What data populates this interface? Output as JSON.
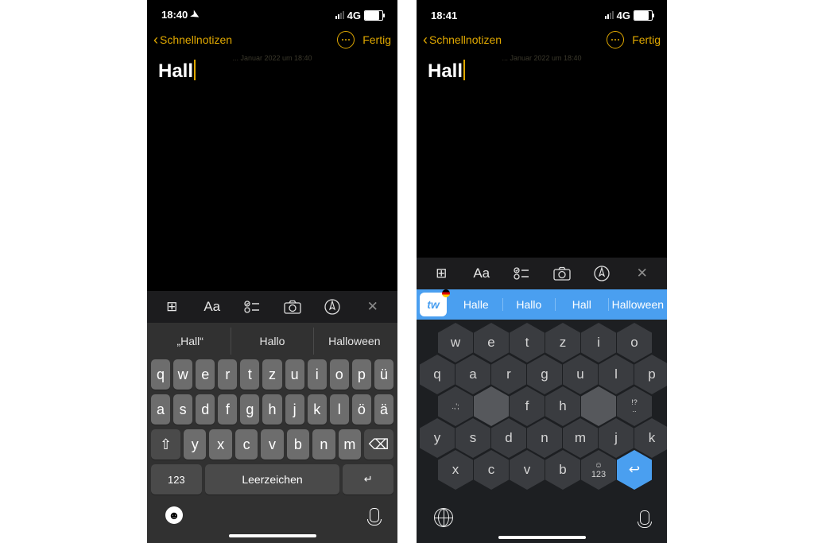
{
  "left": {
    "status": {
      "time": "18:40",
      "net": "4G"
    },
    "header": {
      "back": "Schnellnotizen",
      "done": "Fertig"
    },
    "note": {
      "timestamp": "... Januar 2022 um 18:40",
      "text": "Hall"
    },
    "preds": [
      "„Hall“",
      "Hallo",
      "Halloween"
    ],
    "rows": {
      "r1": [
        "q",
        "w",
        "e",
        "r",
        "t",
        "z",
        "u",
        "i",
        "o",
        "p",
        "ü"
      ],
      "r2": [
        "a",
        "s",
        "d",
        "f",
        "g",
        "h",
        "j",
        "k",
        "l",
        "ö",
        "ä"
      ],
      "r3": [
        "y",
        "x",
        "c",
        "v",
        "b",
        "n",
        "m"
      ],
      "num": "123",
      "space": "Leerzeichen"
    }
  },
  "right": {
    "status": {
      "time": "18:41",
      "net": "4G"
    },
    "header": {
      "back": "Schnellnotizen",
      "done": "Fertig"
    },
    "note": {
      "timestamp": "... Januar 2022 um 18:40",
      "text": "Hall"
    },
    "preds": [
      "Halle",
      "Hallo",
      "Hall",
      "Halloween"
    ],
    "hex": {
      "r1": [
        "w",
        "e",
        "t",
        "z",
        "i",
        "o"
      ],
      "r2": [
        "q",
        "a",
        "r",
        "g",
        "u",
        "l",
        "p"
      ],
      "r3a": ".,';",
      "r3b": [
        "f",
        "h"
      ],
      "r3c": "!?\n..",
      "r4": [
        "y",
        "s",
        "d",
        "n",
        "m",
        "j",
        "k"
      ],
      "r5": [
        "x",
        "c",
        "v",
        "b"
      ],
      "num": "123"
    }
  }
}
